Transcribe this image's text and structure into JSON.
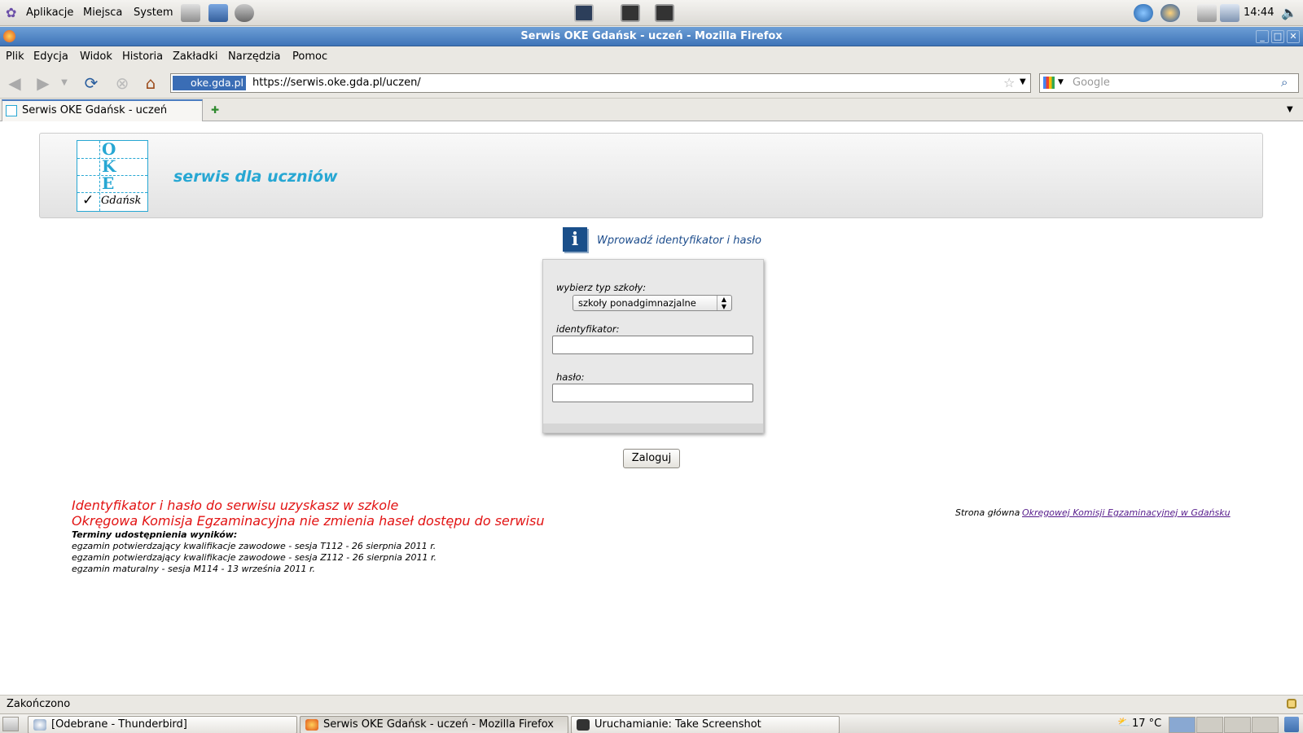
{
  "top_panel": {
    "menus": [
      "Aplikacje",
      "Miejsca",
      "System"
    ],
    "clock": "14:44",
    "icons": [
      "gnome-foot-icon",
      "mail-launcher-icon",
      "computer-launcher-icon",
      "help-launcher-icon",
      "terminal-icon",
      "network-icon",
      "browser-tray-icon",
      "thunderbird-tray-icon",
      "printer-icon",
      "volume-icon"
    ]
  },
  "window": {
    "title": "Serwis OKE Gdańsk - uczeń - Mozilla Firefox",
    "controls": {
      "minimize": "_",
      "maximize": "□",
      "close": "✕"
    }
  },
  "menubar": {
    "items": [
      "Plik",
      "Edycja",
      "Widok",
      "Historia",
      "Zakładki",
      "Narzędzia",
      "Pomoc"
    ]
  },
  "navbar": {
    "site_identity": "oke.gda.pl",
    "url": "https://serwis.oke.gda.pl/uczen/",
    "search_placeholder": "Google"
  },
  "tabs": {
    "active_label": "Serwis OKE Gdańsk - uczeń",
    "new_tab": "✚",
    "list_tabs": "▼"
  },
  "page": {
    "logo": {
      "letters": [
        "O",
        "K",
        "E"
      ],
      "checkmark": "✓",
      "city": "Gdańsk"
    },
    "subtitle": "serwis dla uczniów",
    "info_icon_glyph": "i",
    "info_message": "Wprowadź identyfikator i hasło",
    "form": {
      "school_type_label": "wybierz typ szkoły:",
      "school_type_selected": "szkoły ponadgimnazjalne",
      "identifier_label": "identyfikator:",
      "identifier_value": "",
      "password_label": "hasło:",
      "password_value": "",
      "submit_label": "Zaloguj"
    },
    "notice_lines": [
      "Identyfikator i hasło do serwisu uzyskasz w szkole",
      "Okręgowa Komisja Egzaminacyjna nie zmienia haseł dostępu do serwisu"
    ],
    "results_heading": "Terminy udostępnienia wyników:",
    "results_lines": [
      "egzamin potwierdzający kwalifikacje zawodowe - sesja T112 - 26 sierpnia 2011 r.",
      "egzamin potwierdzający kwalifikacje zawodowe - sesja Z112 - 26 sierpnia 2011 r.",
      "egzamin maturalny - sesja M114 - 13 września 2011 r."
    ],
    "home_prefix": "Strona główna",
    "home_link": "Okręgowej Komisji Egzaminacyjnej w Gdańsku"
  },
  "statusbar": {
    "text": "Zakończono"
  },
  "taskbar": {
    "tasks": [
      "[Odebrane - Thunderbird]",
      "Serwis OKE Gdańsk - uczeń - Mozilla Firefox",
      "Uruchamianie: Take Screenshot"
    ],
    "weather": "17 °C"
  },
  "colors": {
    "accent": "#27a7d3",
    "notice": "#e21313",
    "titlebar": "#3f74b8"
  }
}
